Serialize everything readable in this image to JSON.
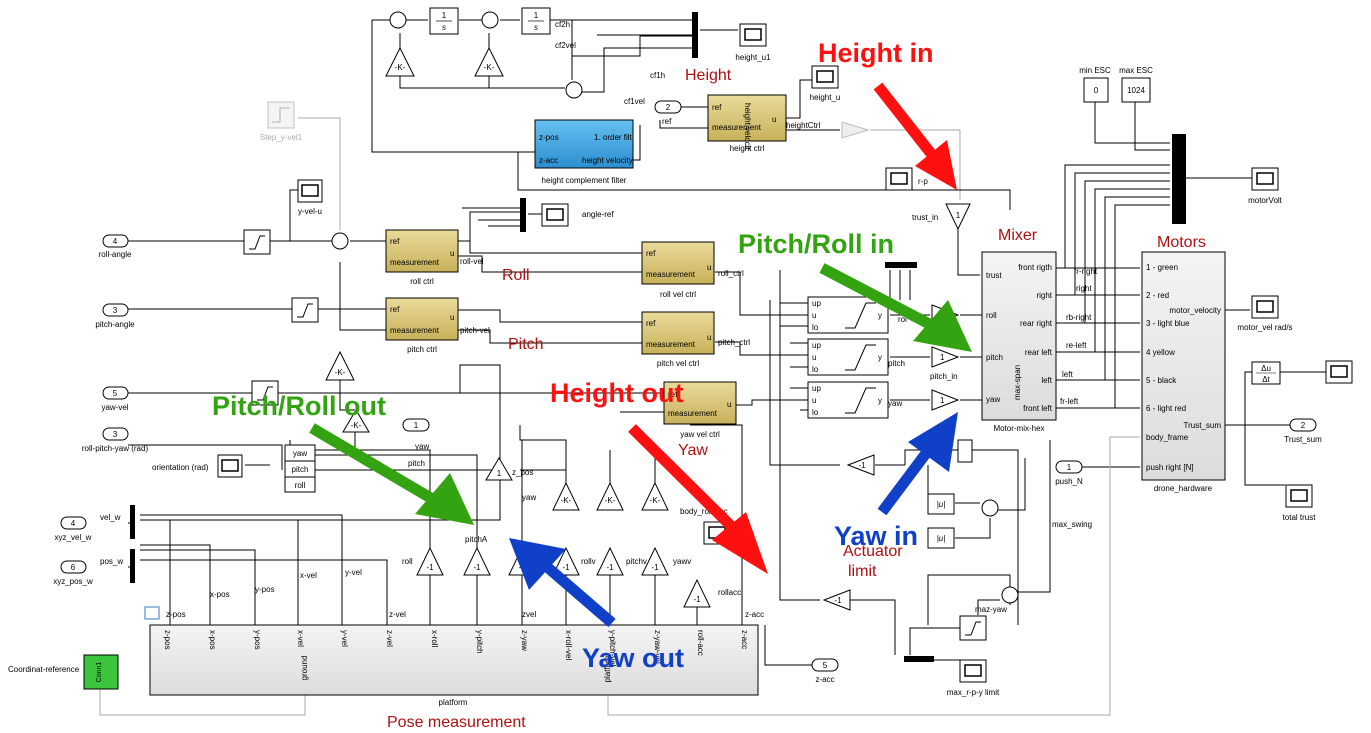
{
  "colors": {
    "subsystem_gold": "#d8c476",
    "filter_blue": "#3fa5dd",
    "annotation_red": "#ff1010",
    "annotation_green": "#34a312",
    "annotation_blue": "#1140c8",
    "section_label_red": "#b01010",
    "conn_green": "#3cc43c"
  },
  "annotations": {
    "height_in": "Height in",
    "pitch_roll_in": "Pitch/Roll in",
    "height_out": "Height out",
    "pitch_roll_out": "Pitch/Roll out",
    "yaw_in": "Yaw in",
    "yaw_out": "Yaw out"
  },
  "section_labels": {
    "height": "Height",
    "roll": "Roll",
    "pitch": "Pitch",
    "yaw": "Yaw",
    "mixer": "Mixer",
    "motors": "Motors",
    "actuator_limit_1": "Actuator",
    "actuator_limit_2": "limit",
    "pose_measurement": "Pose measurement"
  },
  "inports": [
    {
      "num": "4",
      "label": "roll-angle"
    },
    {
      "num": "3",
      "label": "pitch-angle"
    },
    {
      "num": "5",
      "label": "yaw-vel"
    },
    {
      "num": "2",
      "label": ""
    },
    {
      "num": "1",
      "label": "push_N"
    }
  ],
  "outports": [
    {
      "num": "3",
      "label": "roll-pitch-yaw (rad)"
    },
    {
      "num": "4",
      "label": "xyz_vel_w"
    },
    {
      "num": "6",
      "label": "xyz_pos_w"
    },
    {
      "num": "1",
      "label": ""
    },
    {
      "num": "5",
      "label": "z-acc"
    },
    {
      "num": "2",
      "label": "Trust_sum"
    }
  ],
  "scopes": {
    "height_u1": "height_u1",
    "height_u": "height_u",
    "y_vel_u": "y-vel-u",
    "angle_ref": "angle-ref",
    "motor_volt": "motorVolt",
    "motor_vel": "motor_vel rad/s",
    "total_trust": "total trust",
    "orientation": "orientation (rad)",
    "max_rpy": "max_r-p-y limit",
    "r_p": "r-p"
  },
  "integrators": {
    "sym": "1",
    "den": "s"
  },
  "gains": {
    "k": "-K-",
    "neg1": "-1",
    "one": "1"
  },
  "step_block": "Step_y-vel1",
  "ctrl_ports": {
    "ref": "ref",
    "meas": "measurement",
    "u": "u"
  },
  "controllers": {
    "roll_ctrl": "roll ctrl",
    "pitch_ctrl": "pitch ctrl",
    "roll_vel_ctrl": "roll vel ctrl",
    "pitch_vel_ctrl": "pitch vel ctrl",
    "yaw_vel_ctrl": "yaw vel ctrl",
    "height_ctrl": "height ctrl",
    "height_velocity": "height velocit"
  },
  "filter": {
    "name": "height complement filter",
    "in1": "z-pos",
    "in2": "z-acc",
    "title": "1. order filt",
    "out": "height velocity"
  },
  "constants": {
    "min_label": "min ESC",
    "min_val": "0",
    "max_label": "max ESC",
    "max_val": "1024"
  },
  "mixer": {
    "name": "Motor-mix-hex",
    "inputs": [
      "trust",
      "roll",
      "pitch",
      "yaw"
    ],
    "outputs": [
      "front rigth",
      "right",
      "rear right",
      "rear left",
      "left",
      "front left"
    ],
    "bottom": "max-span"
  },
  "hardware": {
    "name": "drone_hardware",
    "inputs": [
      "1 - green",
      "2 - red",
      "3 - light blue",
      "4 yellow",
      "5 - black",
      "6 - light red",
      "body_frame",
      "push right [N]"
    ],
    "outputs": [
      "motor_velocity",
      "Trust_sum"
    ]
  },
  "derivative": {
    "num": "Δu",
    "den": "Δt"
  },
  "abs_label": "|u|",
  "sat_ports": {
    "up": "up",
    "u": "u",
    "lo": "lo",
    "y": "y"
  },
  "platform": {
    "name": "platform",
    "ports": [
      "z-pos",
      "x-pos",
      "y-pos",
      "x-vel",
      "y-vel",
      "z-vel",
      "x-roll",
      "y-pitch",
      "z-yaw",
      "x-roll-vel",
      "y-pitch-vel",
      "z-yaw-vel",
      "roll-acc",
      "z-acc"
    ],
    "bottom_ports": [
      "ground",
      "platform"
    ]
  },
  "conn": {
    "block": "Conn1",
    "label": "Coordinat-reference"
  },
  "rpy": [
    "yaw",
    "pitch",
    "roll"
  ],
  "signals": {
    "cf2h": "cf2h",
    "cf2vel": "cf2vel",
    "cf1h": "cf1h",
    "cf1vel": "cf1vel",
    "ref": "ref",
    "height_ctrl": "heightCtrl",
    "trust_in": "trust_in",
    "roll_vel": "roll-vel",
    "pitch_vel": "pitch-vel",
    "roll_ctrl": "roll_ctrl",
    "pitch_ctrl": "pitch_ctrl",
    "yaw_ctrl": "yaw",
    "pitch_sig": "pitch",
    "pitch_in": "pitch_in",
    "roll_sig": "roll",
    "roll_up": "rol",
    "vel_w": "vel_w",
    "pos_w": "pos_w",
    "z_pos": "z_pos",
    "yaw": "yaw",
    "pitch": "pitch",
    "pitch_a": "pitchA",
    "roll": "roll",
    "roll_v": "rollv",
    "pitch_v": "pitchv",
    "yaw_v": "yawv",
    "body_roll_acc": "body_roll-acc",
    "roll_acc": "rollacc",
    "z_pos2": "z-pos",
    "x_pos": "x-pos",
    "y_pos": "y-pos",
    "x_vel": "x-vel",
    "y_vel": "y-vel",
    "z_vel": "z-vel",
    "zvel": "zvel",
    "z_acc": "z-acc",
    "fr_right": "fr-right",
    "right": "right",
    "rb_right": "rb-right",
    "re_left": "re-left",
    "left": "left",
    "fr_left": "fr-left",
    "max_swing": "max_swing",
    "maz_yaw": "maz-yaw"
  }
}
